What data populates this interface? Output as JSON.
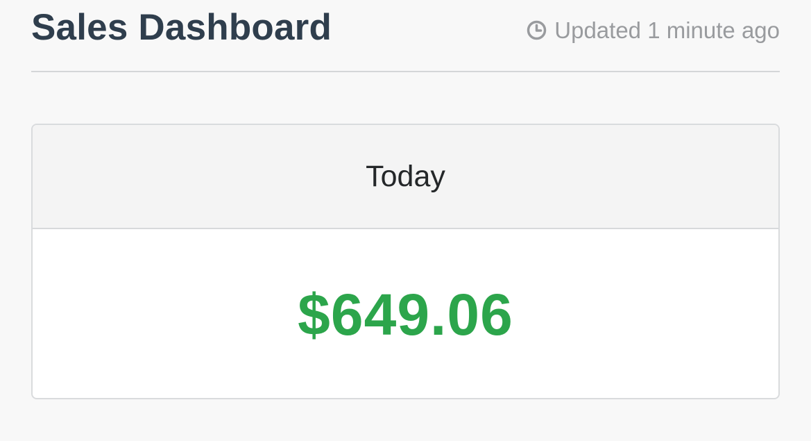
{
  "header": {
    "title": "Sales Dashboard",
    "updated_icon": "clock-icon",
    "updated_text": "Updated 1 minute ago"
  },
  "card": {
    "label": "Today",
    "value": "$649.06",
    "value_color": "#2ca54b"
  }
}
